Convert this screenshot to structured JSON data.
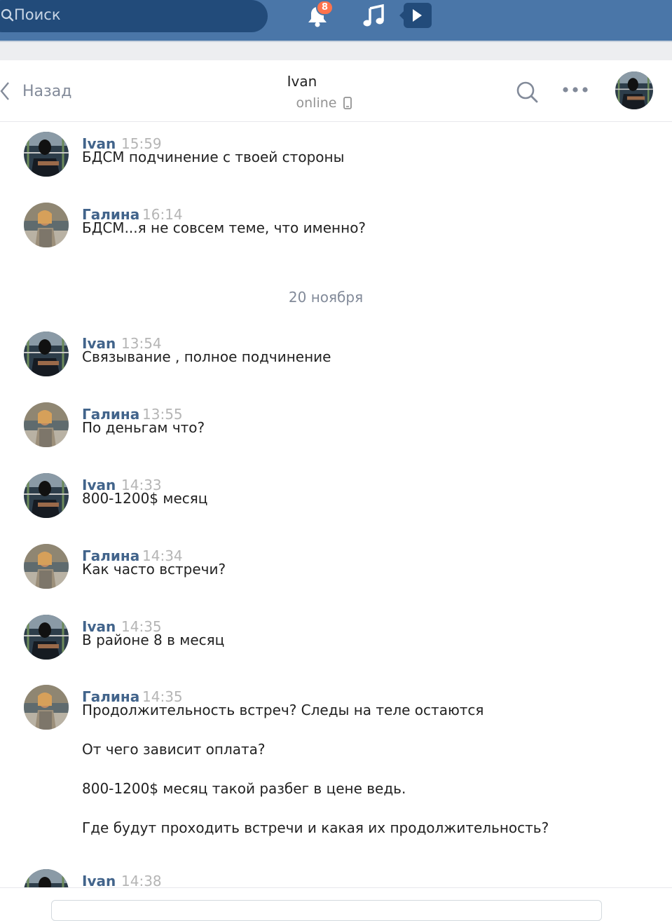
{
  "topbar": {
    "search_placeholder": "Поиск",
    "notifications_count": "8",
    "colors": {
      "bar": "#4a76a8",
      "search": "#224b7a",
      "badge": "#ff734c"
    }
  },
  "header": {
    "back_label": "Назад",
    "contact_name": "Ivan",
    "contact_status": "online"
  },
  "date_separator": "20 ноября",
  "messages": [
    {
      "author": "Ivan",
      "time": "15:59",
      "text": "БДСМ подчинение с твоей стороны"
    },
    {
      "author": "Галина",
      "time": "16:14",
      "text": "БДСМ...я не совсем теме, что именно?"
    },
    {
      "author": "Ivan",
      "time": "13:54",
      "text": "Связывание , полное подчинение"
    },
    {
      "author": "Галина",
      "time": "13:55",
      "text": "По деньгам что?"
    },
    {
      "author": "Ivan",
      "time": "14:33",
      "text": "800-1200$ месяц"
    },
    {
      "author": "Галина",
      "time": "14:34",
      "text": "Как часто встречи?"
    },
    {
      "author": "Ivan",
      "time": "14:35",
      "text": "В районе 8 в месяц"
    },
    {
      "author": "Галина",
      "time": "14:35",
      "text": "Продолжительность встреч? Следы на теле остаются\nОт чего зависит оплата?\n800-1200$ месяц такой разбег в цене ведь.\nГде будут проходить встречи и какая их продолжительность?"
    },
    {
      "author": "Ivan",
      "time": "14:38",
      "text": ""
    }
  ]
}
